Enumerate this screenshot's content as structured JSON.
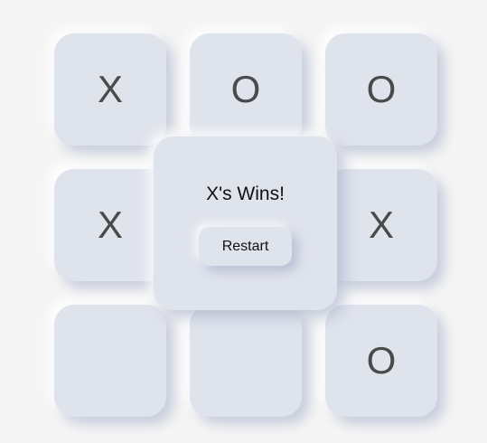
{
  "board": {
    "cells": [
      "X",
      "O",
      "O",
      "X",
      "",
      "X",
      "",
      "",
      "O"
    ]
  },
  "result": {
    "message": "X's Wins!",
    "restart_label": "Restart"
  }
}
